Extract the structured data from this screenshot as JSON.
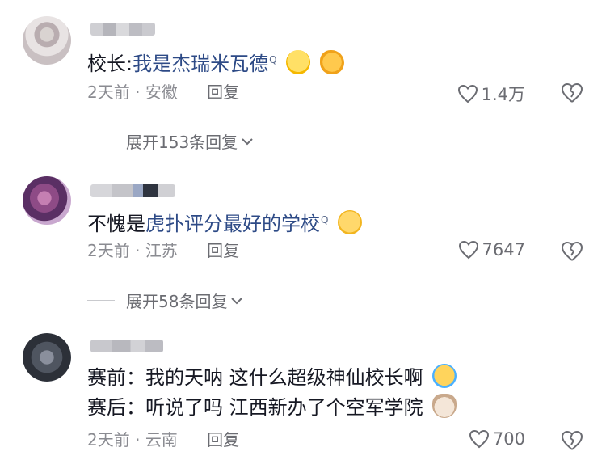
{
  "comments": [
    {
      "content_prefix": "校长:",
      "content_link": "我是杰瑞米瓦德",
      "link_mark": "Q",
      "emojis": [
        "laughing-tears-emoji",
        "ok-hand-emoji"
      ],
      "time": "2天前",
      "separator": " · ",
      "location": "安徽",
      "reply_label": "回复",
      "likes": "1.4万",
      "expand_text": "展开153条回复"
    },
    {
      "content_prefix": "不愧是",
      "content_link": "虎扑评分最好的学校",
      "link_mark": "Q",
      "emojis": [
        "pleading-face-emoji"
      ],
      "time": "2天前",
      "separator": " · ",
      "location": "江苏",
      "reply_label": "回复",
      "likes": "7647",
      "expand_text": "展开58条回复"
    },
    {
      "line1": "赛前：我的天呐  这什么超级神仙校长啊",
      "line2": "赛后：听说了吗  江西新办了个空军学院",
      "emojis": [
        "crying-face-emoji",
        "cat-face-emoji"
      ],
      "time": "2天前",
      "separator": " · ",
      "location": "云南",
      "reply_label": "回复",
      "likes": "700"
    }
  ],
  "colors": {
    "text": "#161823",
    "link": "#2d4a86",
    "meta": "#8a8b91"
  }
}
